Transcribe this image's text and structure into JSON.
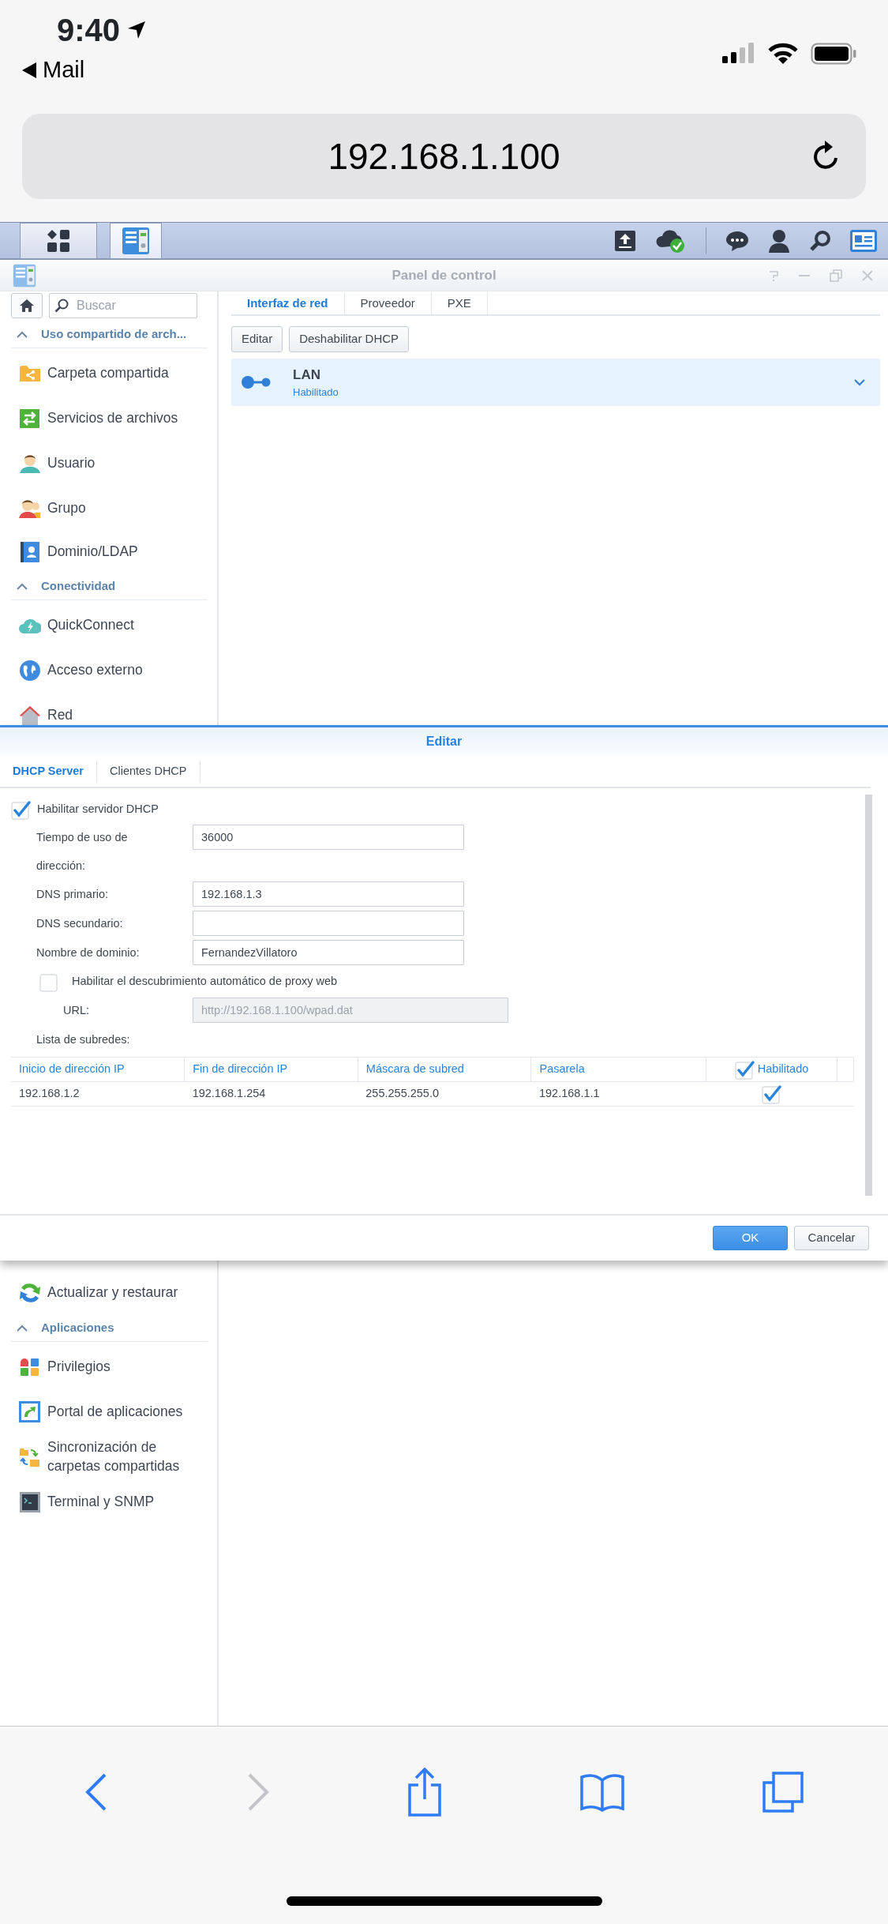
{
  "status_bar": {
    "time": "9:40",
    "back_app": "Mail"
  },
  "address_bar": {
    "url": "192.168.1.100"
  },
  "window": {
    "title": "Panel de control"
  },
  "sidebar": {
    "search": {
      "placeholder": "Buscar"
    },
    "sections": [
      {
        "title": "Uso compartido de arch...",
        "expanded": true,
        "items": [
          {
            "label": "Carpeta compartida"
          },
          {
            "label": "Servicios de archivos"
          },
          {
            "label": "Usuario"
          },
          {
            "label": "Grupo"
          },
          {
            "label": "Dominio/LDAP"
          }
        ]
      },
      {
        "title": "Conectividad",
        "expanded": true,
        "items": [
          {
            "label": "QuickConnect"
          },
          {
            "label": "Acceso externo"
          },
          {
            "label": "Red"
          }
        ]
      },
      {
        "items": [
          {
            "label": "Actualizar y restaurar"
          }
        ]
      },
      {
        "title": "Aplicaciones",
        "expanded": true,
        "items": [
          {
            "label": "Privilegios"
          },
          {
            "label": "Portal de aplicaciones"
          },
          {
            "label": "Sincronización de carpetas compartidas"
          },
          {
            "label": "Terminal y SNMP"
          }
        ]
      }
    ]
  },
  "main": {
    "tabs": [
      {
        "label": "Interfaz de red",
        "selected": true
      },
      {
        "label": "Proveedor",
        "selected": false
      },
      {
        "label": "PXE",
        "selected": false
      }
    ],
    "buttons": [
      "Editar",
      "Deshabilitar DHCP"
    ],
    "interfaces": [
      {
        "name": "LAN",
        "status": "Habilitado",
        "expanded": false
      }
    ]
  },
  "dialog": {
    "title": "Editar",
    "tabs": [
      {
        "label": "DHCP Server",
        "selected": true
      },
      {
        "label": "Clientes DHCP",
        "selected": false
      }
    ],
    "enable_dhcp": {
      "label": "Habilitar servidor DHCP",
      "checked": true
    },
    "fields": [
      {
        "label": "Tiempo de uso de dirección:",
        "value": "36000"
      },
      {
        "label": "DNS primario:",
        "value": "192.168.1.3"
      },
      {
        "label": "DNS secundario:"
      },
      {
        "label": "Nombre de dominio:",
        "value": "FernandezVillatoro"
      }
    ],
    "proxy": {
      "label": "Habilitar el descubrimiento automático de proxy web",
      "checked": false
    },
    "url_field": {
      "label": "URL:",
      "value": "http://192.168.1.100/wpad.dat",
      "disabled": true
    },
    "subnets_label": "Lista de subredes:",
    "table": {
      "columns": [
        "Inicio de dirección IP",
        "Fin de dirección IP",
        "Máscara de subred",
        "Pasarela",
        "Habilitado"
      ],
      "header_checked": true,
      "rows": [
        {
          "cells": [
            "192.168.1.2",
            "192.168.1.254",
            "255.255.255.0",
            "192.168.1.1"
          ],
          "enabled": true
        }
      ]
    },
    "buttons": [
      {
        "label": "OK",
        "primary": true
      },
      {
        "label": "Cancelar",
        "primary": false
      }
    ]
  },
  "browser_toolbar": {
    "back": {
      "disabled": false
    },
    "forward": {
      "disabled": true
    }
  }
}
